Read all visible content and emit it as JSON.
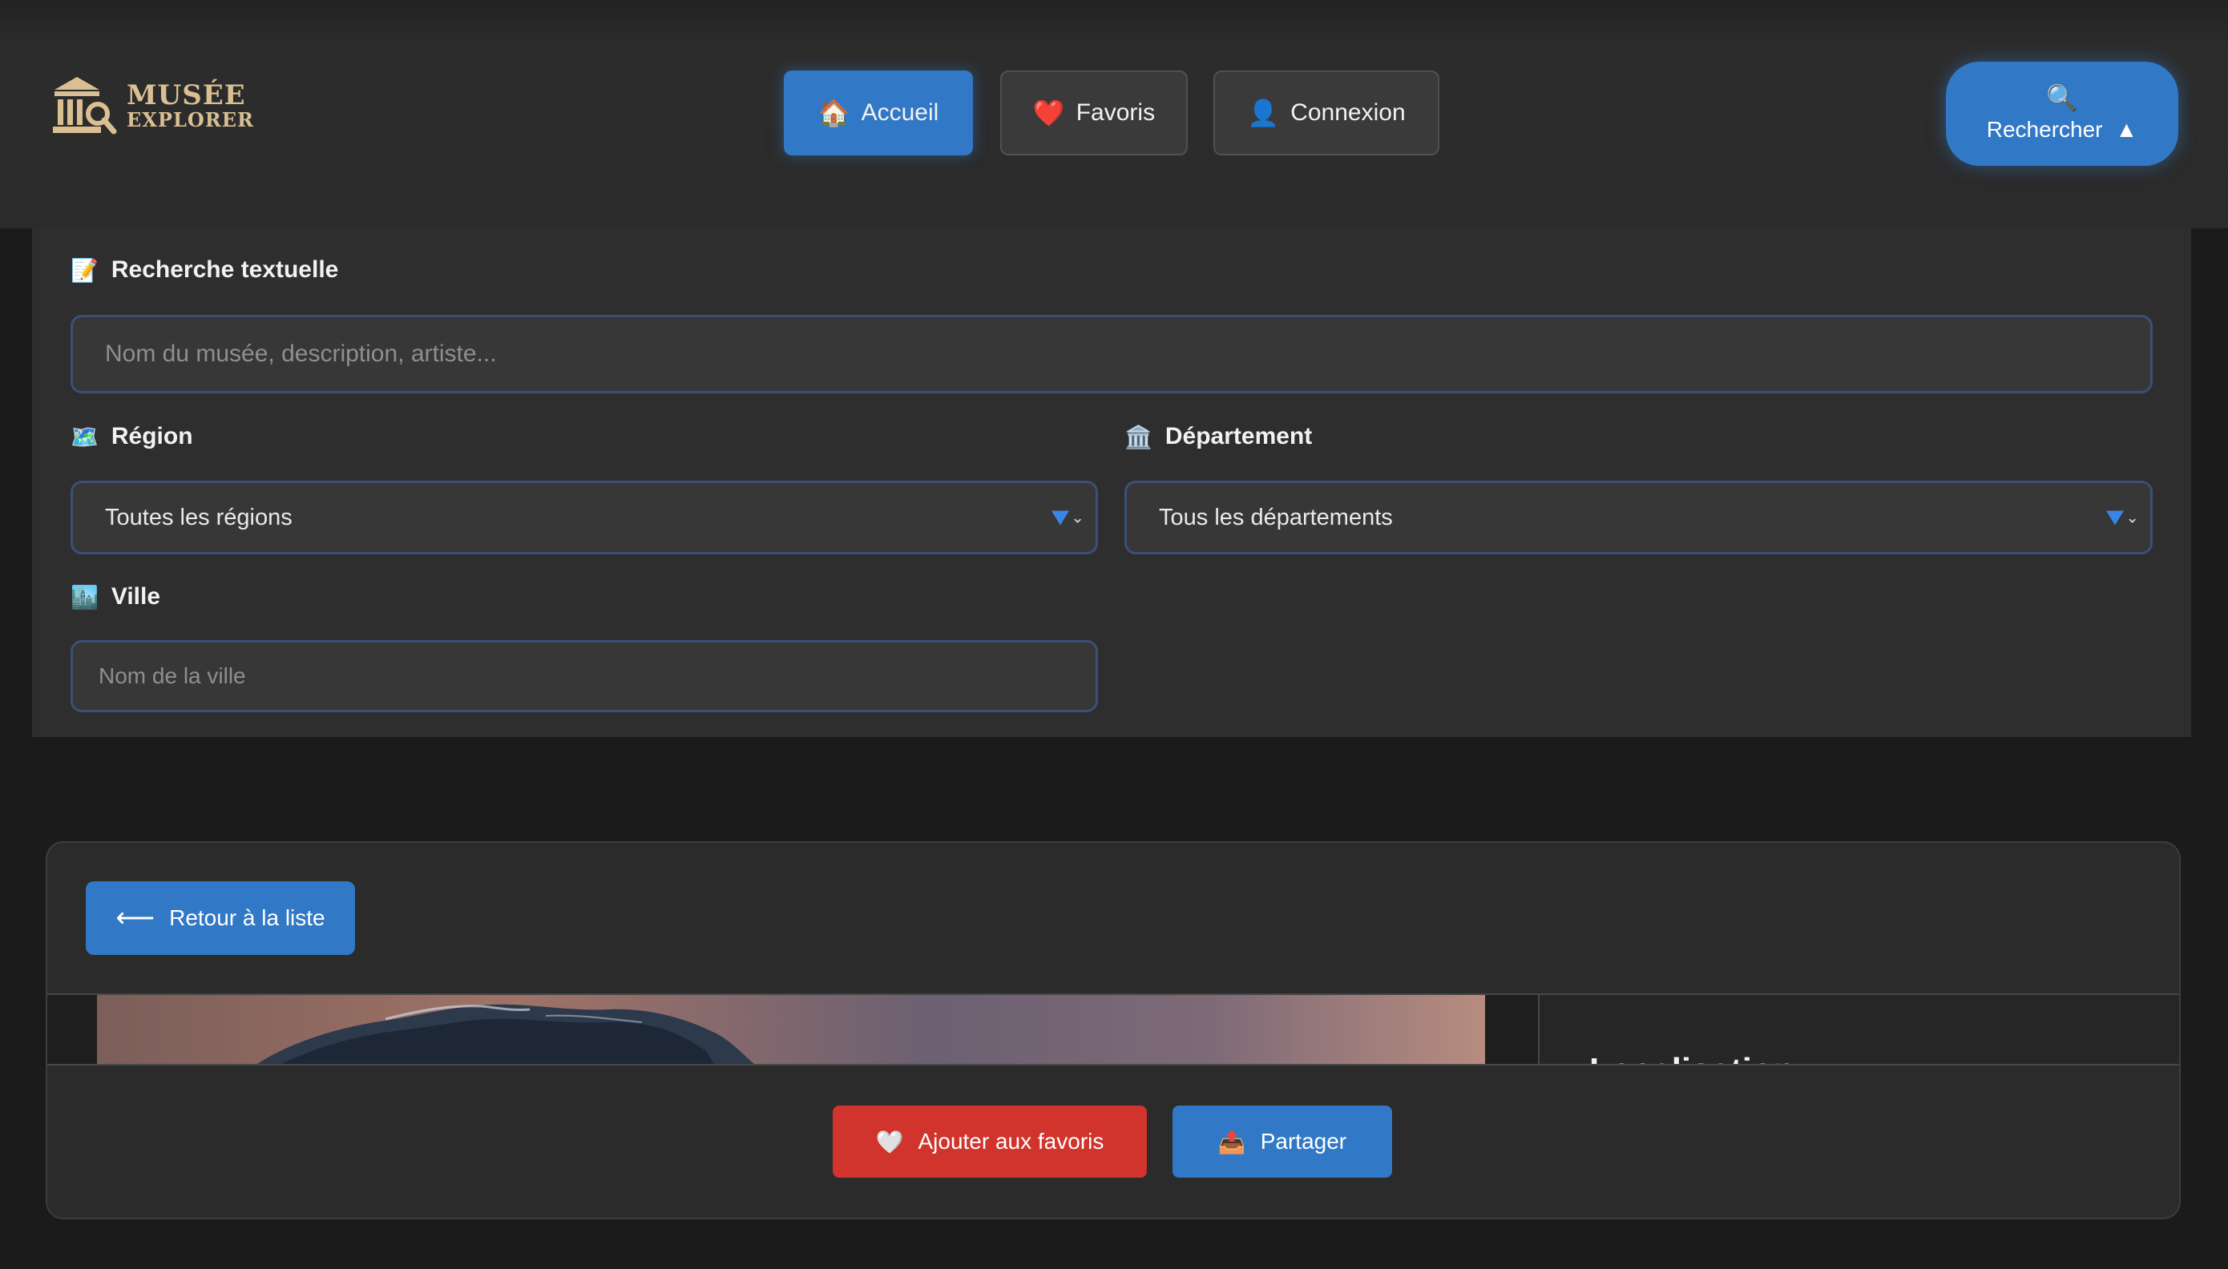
{
  "brand": {
    "line1": "MUSÉE",
    "line2": "EXPLORER",
    "color": "#d9bf92"
  },
  "nav": {
    "home": {
      "icon": "house-icon",
      "glyph": "🏠",
      "label": "Accueil"
    },
    "favorites": {
      "icon": "heart-icon",
      "glyph": "❤️",
      "label": "Favoris"
    },
    "login": {
      "icon": "user-icon",
      "glyph": "👤",
      "label": "Connexion"
    }
  },
  "search_toggle": {
    "icon_glyph": "🔍",
    "label": "Rechercher",
    "caret": "▲"
  },
  "search_panel": {
    "text_search": {
      "icon_glyph": "📝",
      "label": "Recherche textuelle",
      "placeholder": "Nom du musée, description, artiste..."
    },
    "region": {
      "icon_glyph": "🗺️",
      "label": "Région",
      "value": "Toutes les régions"
    },
    "department": {
      "icon_glyph": "🏛️",
      "label": "Département",
      "value": "Tous les départements"
    },
    "city": {
      "icon_glyph": "🏙️",
      "label": "Ville",
      "placeholder": "Nom de la ville"
    }
  },
  "detail": {
    "back_arrow": "⟵",
    "back_label": "Retour à la liste",
    "side_title": "Localisation",
    "actions": {
      "favorite": {
        "icon_glyph": "🤍",
        "label": "Ajouter aux favoris"
      },
      "share": {
        "icon_glyph": "📤",
        "label": "Partager"
      }
    }
  },
  "colors": {
    "accent": "#3178c6",
    "danger": "#d0342c",
    "background": "#1b1b1b",
    "panel": "#2e2e2e"
  }
}
